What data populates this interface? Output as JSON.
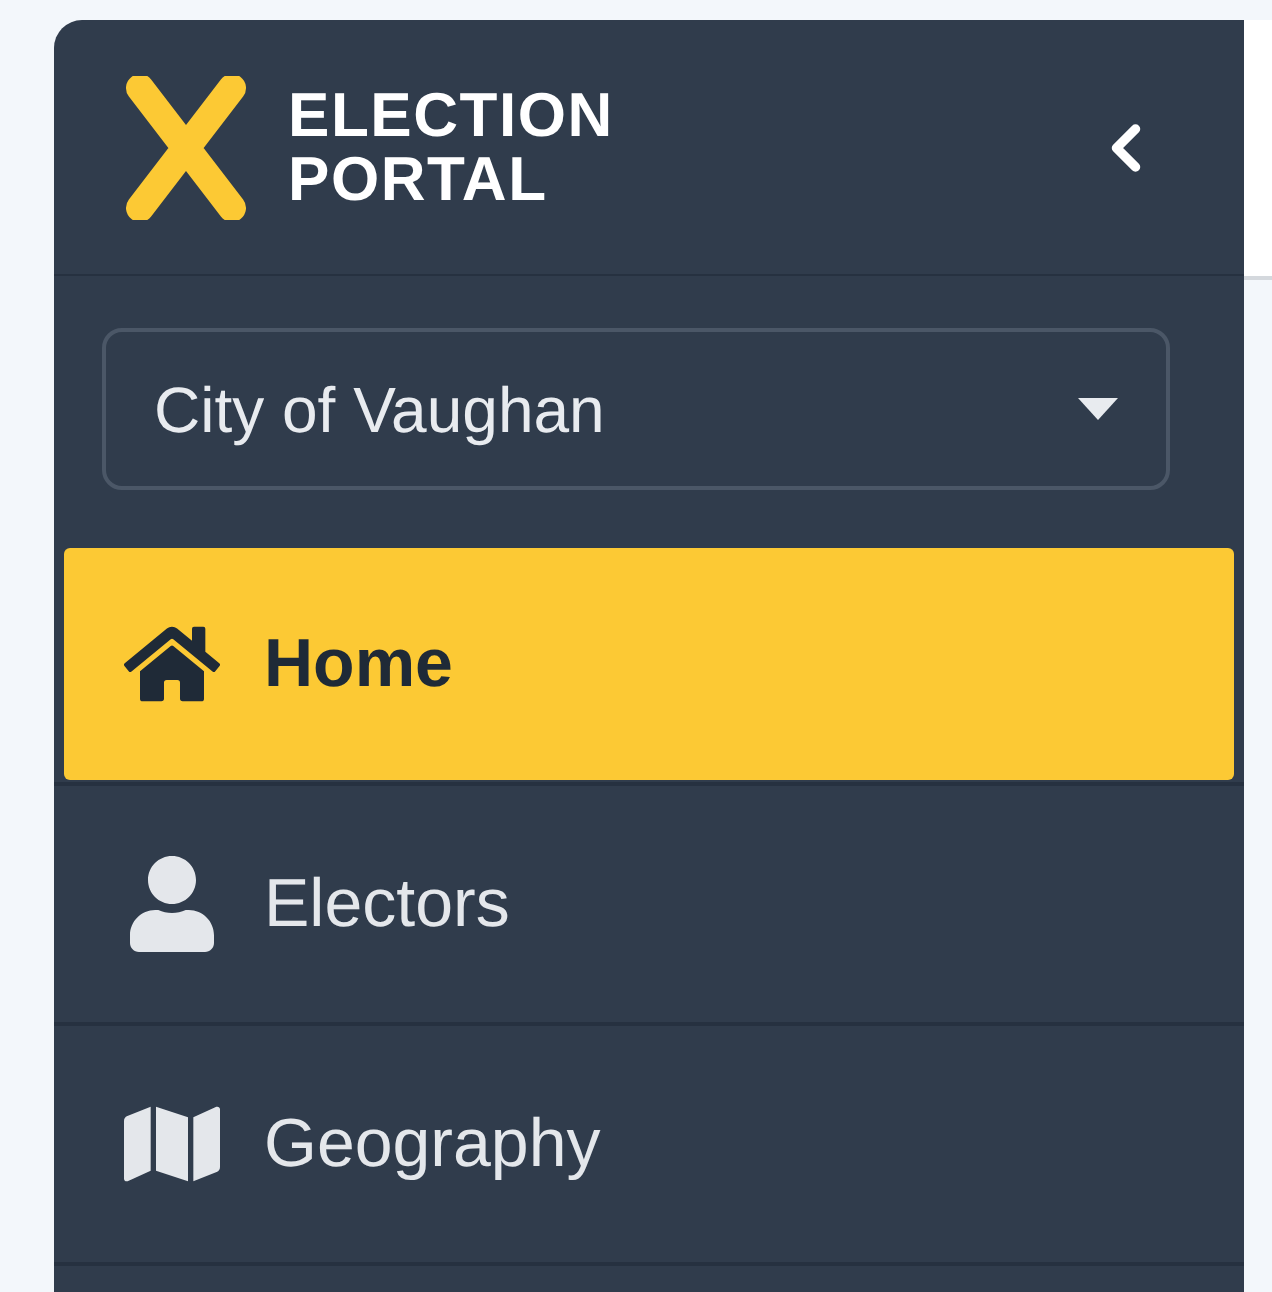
{
  "brand": {
    "lines": [
      "ELECTION",
      "PORTAL"
    ]
  },
  "selector": {
    "value": "City of Vaughan"
  },
  "nav": [
    {
      "kind": "home",
      "label": "Home",
      "selected": true
    },
    {
      "kind": "user",
      "label": "Electors",
      "selected": false
    },
    {
      "kind": "map",
      "label": "Geography",
      "selected": false
    }
  ]
}
